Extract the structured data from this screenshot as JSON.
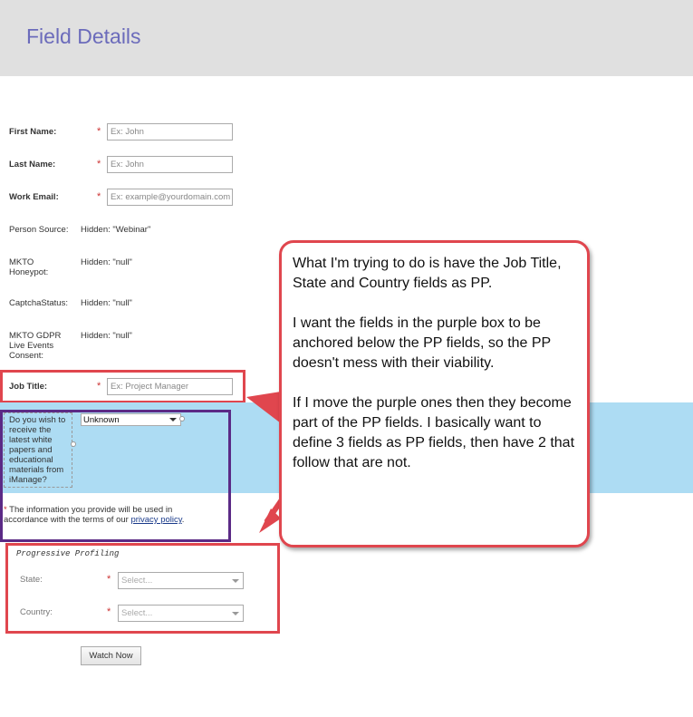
{
  "header": {
    "title": "Field Details"
  },
  "form": {
    "first_name": {
      "label": "First Name:",
      "placeholder": "Ex: John"
    },
    "last_name": {
      "label": "Last Name:",
      "placeholder": "Ex: John"
    },
    "work_email": {
      "label": "Work Email:",
      "placeholder": "Ex: example@yourdomain.com"
    },
    "person_source": {
      "label": "Person Source:",
      "value": "Hidden: \"Webinar\""
    },
    "honeypot": {
      "label": "MKTO Honeypot:",
      "value": "Hidden: \"null\""
    },
    "captcha": {
      "label": "CaptchaStatus:",
      "value": "Hidden: \"null\""
    },
    "gdpr": {
      "label": "MKTO GDPR Live Events Consent:",
      "value": "Hidden: \"null\""
    },
    "job_title": {
      "label": "Job Title:",
      "placeholder": "Ex: Project Manager"
    },
    "whitepaper": {
      "question": "Do you wish to receive the latest white papers and educational materials from iManage?",
      "selected": "Unknown"
    },
    "disclaimer": {
      "asterisk": "*",
      "text": " The information you provide will be used in accordance with the terms of our ",
      "link": "privacy policy",
      "end": "."
    },
    "progressive": {
      "legend": "Progressive Profiling",
      "state": {
        "label": "State:",
        "selected": "Select..."
      },
      "country": {
        "label": "Country:",
        "selected": "Select..."
      }
    },
    "required_mark": "*",
    "submit_label": "Watch Now"
  },
  "callout": {
    "paragraphs": [
      "What I'm trying to do is have the Job Title, State and Country fields as PP.",
      "I want the fields in the purple box to be anchored below the PP fields, so the PP doesn't mess with their viability.",
      "If I move the purple ones then they become part of the PP fields. I basically want to define 3 fields as PP fields, then have 2 that follow that are not."
    ]
  },
  "colors": {
    "header_bg": "#e0e0e0",
    "title": "#6b6bbb",
    "highlight_blue": "#addcf3",
    "annotation_red": "#e0464e",
    "annotation_purple": "#5b2a86"
  }
}
